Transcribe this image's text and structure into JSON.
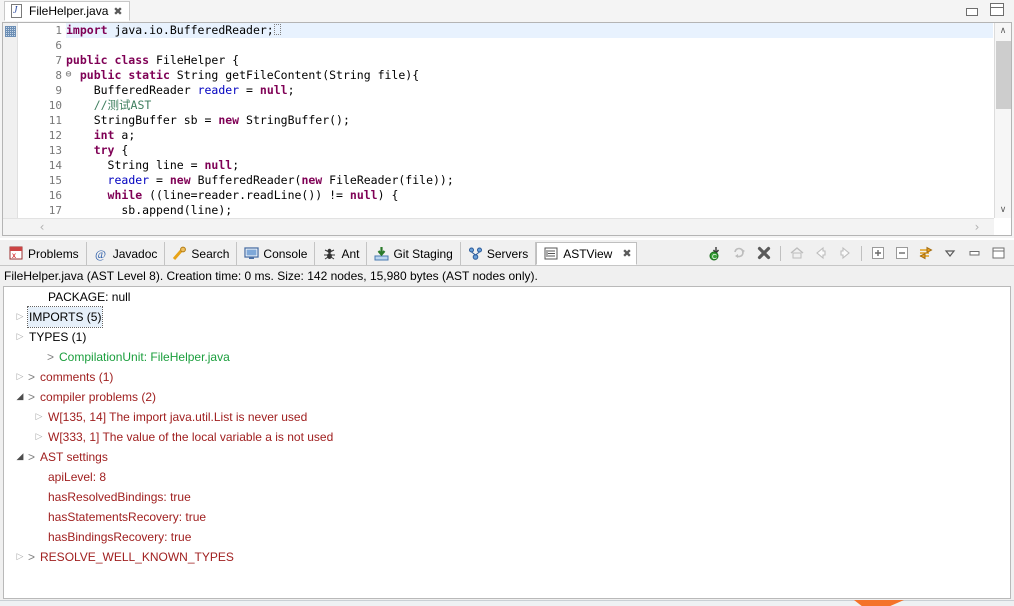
{
  "editor": {
    "tab": {
      "label": "FileHelper.java",
      "icon": "java-file-icon",
      "close_glyph": "✖"
    },
    "window_controls": {
      "minimize": "minimize-icon",
      "maximize": "maximize-icon"
    },
    "lines": [
      {
        "num": "1",
        "fold": "⊕",
        "highlight": true,
        "segments": [
          {
            "t": "import",
            "c": "kw"
          },
          {
            "t": " java.io.BufferedReader;",
            "c": ""
          },
          {
            "t": "▫",
            "c": "caret"
          }
        ]
      },
      {
        "num": "6",
        "fold": "",
        "highlight": false,
        "segments": []
      },
      {
        "num": "7",
        "fold": "",
        "highlight": false,
        "segments": [
          {
            "t": "public class ",
            "c": "kw"
          },
          {
            "t": "FileHelper {",
            "c": ""
          }
        ]
      },
      {
        "num": "8",
        "fold": "⊖",
        "highlight": false,
        "segments": [
          {
            "t": "  ",
            "c": ""
          },
          {
            "t": "public static ",
            "c": "kw"
          },
          {
            "t": "String getFileContent(String file){",
            "c": ""
          }
        ]
      },
      {
        "num": "9",
        "fold": "",
        "highlight": false,
        "segments": [
          {
            "t": "    BufferedReader ",
            "c": ""
          },
          {
            "t": "reader",
            "c": "fld"
          },
          {
            "t": " = ",
            "c": ""
          },
          {
            "t": "null",
            "c": "kw"
          },
          {
            "t": ";",
            "c": ""
          }
        ]
      },
      {
        "num": "10",
        "fold": "",
        "highlight": false,
        "segments": [
          {
            "t": "    //测试AST",
            "c": "cmt"
          }
        ]
      },
      {
        "num": "11",
        "fold": "",
        "highlight": false,
        "segments": [
          {
            "t": "    StringBuffer sb = ",
            "c": ""
          },
          {
            "t": "new ",
            "c": "kw"
          },
          {
            "t": "StringBuffer();",
            "c": ""
          }
        ]
      },
      {
        "num": "12",
        "fold": "",
        "highlight": false,
        "segments": [
          {
            "t": "    ",
            "c": ""
          },
          {
            "t": "int",
            "c": "kw"
          },
          {
            "t": " a;",
            "c": ""
          }
        ]
      },
      {
        "num": "13",
        "fold": "",
        "highlight": false,
        "segments": [
          {
            "t": "    ",
            "c": ""
          },
          {
            "t": "try",
            "c": "kw"
          },
          {
            "t": " {",
            "c": ""
          }
        ]
      },
      {
        "num": "14",
        "fold": "",
        "highlight": false,
        "segments": [
          {
            "t": "      String line = ",
            "c": ""
          },
          {
            "t": "null",
            "c": "kw"
          },
          {
            "t": ";",
            "c": ""
          }
        ]
      },
      {
        "num": "15",
        "fold": "",
        "highlight": false,
        "segments": [
          {
            "t": "      ",
            "c": ""
          },
          {
            "t": "reader",
            "c": "fld"
          },
          {
            "t": " = ",
            "c": ""
          },
          {
            "t": "new ",
            "c": "kw"
          },
          {
            "t": "BufferedReader(",
            "c": ""
          },
          {
            "t": "new ",
            "c": "kw"
          },
          {
            "t": "FileReader(file));",
            "c": ""
          }
        ]
      },
      {
        "num": "16",
        "fold": "",
        "highlight": false,
        "segments": [
          {
            "t": "      ",
            "c": ""
          },
          {
            "t": "while ",
            "c": "kw"
          },
          {
            "t": "((line=reader.readLine()) != ",
            "c": ""
          },
          {
            "t": "null",
            "c": "kw"
          },
          {
            "t": ") {",
            "c": ""
          }
        ]
      },
      {
        "num": "17",
        "fold": "",
        "highlight": false,
        "segments": [
          {
            "t": "        sb.append(line);",
            "c": ""
          }
        ]
      }
    ],
    "scroll": {
      "up_arrow": "∧",
      "down_arrow": "∨",
      "left_arrow": "‹",
      "right_arrow": "›"
    }
  },
  "view_part": {
    "tabs": [
      {
        "label": "Problems",
        "icon": "problems-icon",
        "active": false,
        "closable": false
      },
      {
        "label": "Javadoc",
        "icon": "javadoc-icon",
        "active": false,
        "closable": false
      },
      {
        "label": "Search",
        "icon": "search-icon",
        "active": false,
        "closable": false
      },
      {
        "label": "Console",
        "icon": "console-icon",
        "active": false,
        "closable": false
      },
      {
        "label": "Ant",
        "icon": "ant-icon",
        "active": false,
        "closable": false
      },
      {
        "label": "Git Staging",
        "icon": "git-staging-icon",
        "active": false,
        "closable": false
      },
      {
        "label": "Servers",
        "icon": "servers-icon",
        "active": false,
        "closable": false
      },
      {
        "label": "ASTView",
        "icon": "astview-icon",
        "active": true,
        "closable": true
      }
    ],
    "tab_close_glyph": "✖",
    "toolbar": [
      {
        "name": "link-with-editor-button",
        "enabled": true
      },
      {
        "name": "refresh-ast-button",
        "enabled": false
      },
      {
        "name": "clear-button",
        "enabled": true
      },
      {
        "name": "separator-1",
        "enabled": true
      },
      {
        "name": "home-button",
        "enabled": false
      },
      {
        "name": "back-button",
        "enabled": false
      },
      {
        "name": "forward-button",
        "enabled": false
      },
      {
        "name": "separator-2",
        "enabled": true
      },
      {
        "name": "expand-all-button",
        "enabled": true
      },
      {
        "name": "collapse-all-button",
        "enabled": true
      },
      {
        "name": "double-click-action-button",
        "enabled": true
      },
      {
        "name": "view-menu-button",
        "enabled": true
      },
      {
        "name": "minimize-button",
        "enabled": true
      },
      {
        "name": "maximize-button",
        "enabled": true
      }
    ],
    "status_line": "FileHelper.java (AST Level 8).  Creation time: 0 ms.  Size: 142 nodes, 15,980 bytes (AST nodes only).",
    "tree": [
      {
        "indent": 1,
        "twisty": "none",
        "prefix": "",
        "label": "PACKAGE: null",
        "color": "black",
        "selected": false
      },
      {
        "indent": 0,
        "twisty": "collapsed",
        "prefix": "",
        "label": "IMPORTS (5)",
        "color": "black",
        "selected": true
      },
      {
        "indent": 0,
        "twisty": "collapsed",
        "prefix": "",
        "label": "TYPES (1)",
        "color": "black",
        "selected": false
      },
      {
        "indent": 1,
        "twisty": "none",
        "prefix": ">",
        "label": "CompilationUnit: FileHelper.java",
        "color": "green",
        "selected": false
      },
      {
        "indent": 0,
        "twisty": "collapsed",
        "prefix": ">",
        "label": "comments (1)",
        "color": "red",
        "selected": false
      },
      {
        "indent": 0,
        "twisty": "expanded",
        "prefix": ">",
        "label": "compiler problems (2)",
        "color": "red",
        "selected": false
      },
      {
        "indent": 1,
        "twisty": "collapsed",
        "prefix": "",
        "label": "W[135, 14] The import java.util.List is never used",
        "color": "red",
        "selected": false
      },
      {
        "indent": 1,
        "twisty": "collapsed",
        "prefix": "",
        "label": "W[333, 1] The value of the local variable a is not used",
        "color": "red",
        "selected": false
      },
      {
        "indent": 0,
        "twisty": "expanded",
        "prefix": ">",
        "label": "AST settings",
        "color": "red",
        "selected": false
      },
      {
        "indent": 1,
        "twisty": "none",
        "prefix": "",
        "label": "apiLevel: 8",
        "color": "red",
        "selected": false
      },
      {
        "indent": 1,
        "twisty": "none",
        "prefix": "",
        "label": "hasResolvedBindings: true",
        "color": "red",
        "selected": false
      },
      {
        "indent": 1,
        "twisty": "none",
        "prefix": "",
        "label": "hasStatementsRecovery: true",
        "color": "red",
        "selected": false
      },
      {
        "indent": 1,
        "twisty": "none",
        "prefix": "",
        "label": "hasBindingsRecovery: true",
        "color": "red",
        "selected": false
      },
      {
        "indent": 0,
        "twisty": "collapsed",
        "prefix": ">",
        "label": "RESOLVE_WELL_KNOWN_TYPES",
        "color": "red",
        "selected": false
      }
    ]
  },
  "colors": {
    "keyword": "#7f0055",
    "comment": "#3f7f5f",
    "field": "#0000c0",
    "tree_green": "#1a9e3c",
    "tree_red": "#a02020",
    "highlight_line": "#e8f2fe",
    "accent_orange": "#f4732a"
  }
}
